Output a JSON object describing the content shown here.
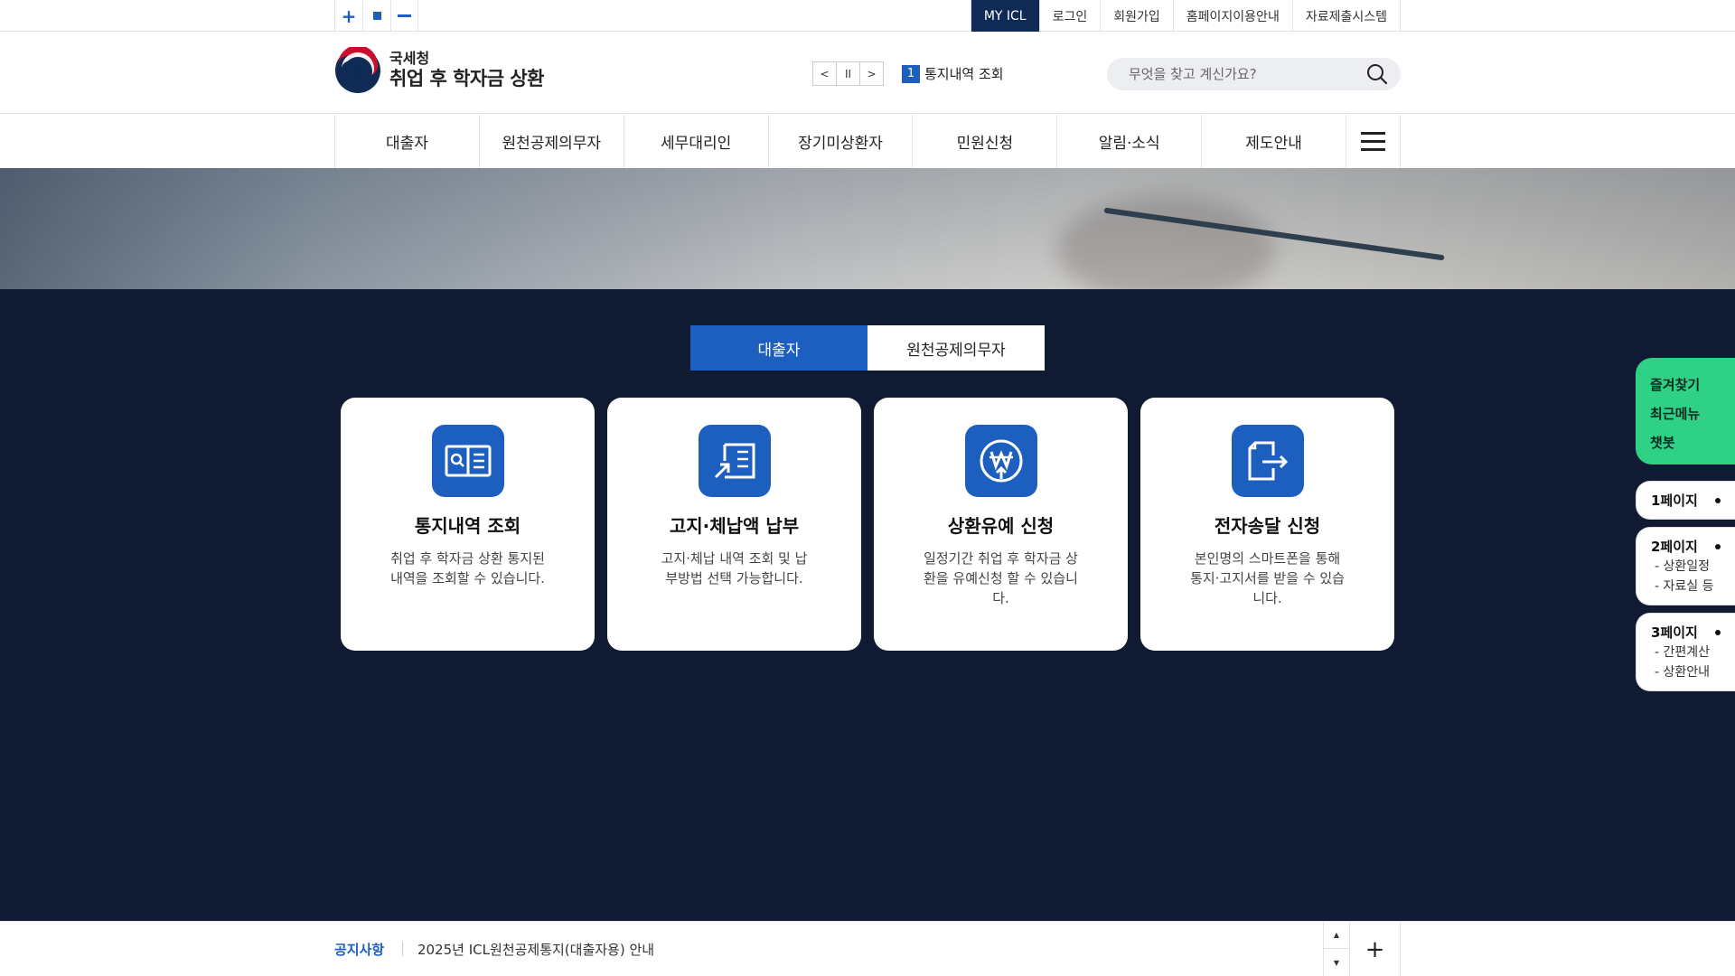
{
  "util": {
    "zoom_in": "+",
    "zoom_reset": "",
    "zoom_out": "",
    "links": [
      "MY ICL",
      "로그인",
      "회원가입",
      "홈페이지이용안내",
      "자료제출시스템"
    ]
  },
  "header": {
    "logo_line1": "국세청",
    "logo_line2": "취업 후 학자금 상환",
    "rolling": {
      "prev": "<",
      "pause": "II",
      "next": ">",
      "index": "1",
      "text": "통지내역 조회"
    },
    "search_placeholder": "무엇을 찾고 계신가요?"
  },
  "gnb": {
    "items": [
      "대출자",
      "원천공제의무자",
      "세무대리인",
      "장기미상환자",
      "민원신청",
      "알림·소식",
      "제도안내"
    ]
  },
  "main": {
    "tabs": [
      "대출자",
      "원천공제의무자"
    ],
    "cards": [
      {
        "title": "통지내역 조회",
        "desc": "취업 후 학자금 상환 통지된 내역을 조회할 수 있습니다.",
        "icon": "document-search-icon"
      },
      {
        "title": "고지·체납액 납부",
        "desc": "고지·체납 내역 조회 및 납부방법 선택 가능합니다.",
        "icon": "document-payment-icon"
      },
      {
        "title": "상환유예 신청",
        "desc": "일정기간 취업 후 학자금 상환을 유예신청 할 수 있습니다.",
        "icon": "won-coin-icon"
      },
      {
        "title": "전자송달 신청",
        "desc": "본인명의 스마트폰을 통해 통지·고지서를 받을 수 있습니다.",
        "icon": "document-send-icon"
      }
    ]
  },
  "quick": {
    "green": [
      "즐겨찾기",
      "최근메뉴",
      "챗봇"
    ],
    "pages": [
      {
        "title": "1페이지",
        "subs": []
      },
      {
        "title": "2페이지",
        "subs": [
          "- 상환일정",
          "- 자료실 등"
        ]
      },
      {
        "title": "3페이지",
        "subs": [
          "- 간편계산",
          "- 상환안내"
        ]
      }
    ]
  },
  "notice": {
    "label": "공지사항",
    "text": "2025년 ICL원천공제통지(대출자용) 안내",
    "up": "▲",
    "down": "▼",
    "more": "+"
  },
  "colors": {
    "primary": "#1d5fbf",
    "dark_bg": "#101b33",
    "quick_green": "#2fd187"
  }
}
